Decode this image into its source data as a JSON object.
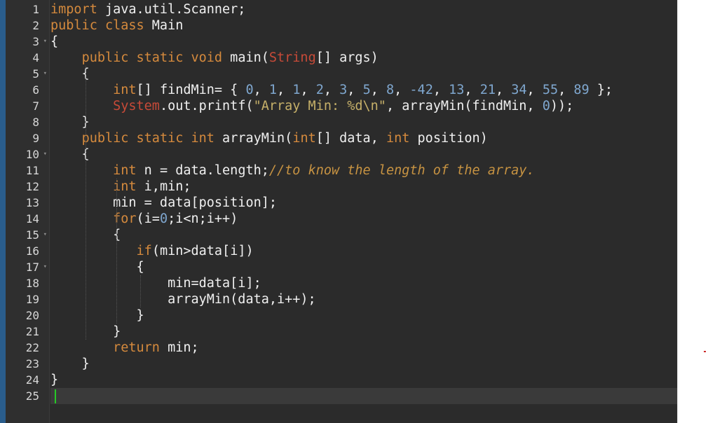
{
  "editor": {
    "lines": [
      {
        "n": "1",
        "fold": "",
        "tokens": [
          [
            "kw",
            "import"
          ],
          [
            "txt",
            " java.util.Scanner;"
          ]
        ]
      },
      {
        "n": "2",
        "fold": "",
        "tokens": [
          [
            "kw",
            "public class"
          ],
          [
            "txt",
            " Main"
          ]
        ]
      },
      {
        "n": "3",
        "fold": "▾",
        "tokens": [
          [
            "txt",
            "{"
          ]
        ]
      },
      {
        "n": "4",
        "fold": "",
        "tokens": [
          [
            "txt",
            "    "
          ],
          [
            "kw",
            "public static void"
          ],
          [
            "txt",
            " main("
          ],
          [
            "red",
            "String"
          ],
          [
            "txt",
            "[] args)"
          ]
        ]
      },
      {
        "n": "5",
        "fold": "▾",
        "tokens": [
          [
            "txt",
            "    {"
          ]
        ]
      },
      {
        "n": "6",
        "fold": "",
        "tokens": [
          [
            "txt",
            "        "
          ],
          [
            "type",
            "int"
          ],
          [
            "txt",
            "[] findMin= { "
          ],
          [
            "num",
            "0"
          ],
          [
            "txt",
            ", "
          ],
          [
            "num",
            "1"
          ],
          [
            "txt",
            ", "
          ],
          [
            "num",
            "1"
          ],
          [
            "txt",
            ", "
          ],
          [
            "num",
            "2"
          ],
          [
            "txt",
            ", "
          ],
          [
            "num",
            "3"
          ],
          [
            "txt",
            ", "
          ],
          [
            "num",
            "5"
          ],
          [
            "txt",
            ", "
          ],
          [
            "num",
            "8"
          ],
          [
            "txt",
            ", "
          ],
          [
            "num",
            "-42"
          ],
          [
            "txt",
            ", "
          ],
          [
            "num",
            "13"
          ],
          [
            "txt",
            ", "
          ],
          [
            "num",
            "21"
          ],
          [
            "txt",
            ", "
          ],
          [
            "num",
            "34"
          ],
          [
            "txt",
            ", "
          ],
          [
            "num",
            "55"
          ],
          [
            "txt",
            ", "
          ],
          [
            "num",
            "89"
          ],
          [
            "txt",
            " };"
          ]
        ]
      },
      {
        "n": "7",
        "fold": "",
        "tokens": [
          [
            "txt",
            "        "
          ],
          [
            "red",
            "System"
          ],
          [
            "txt",
            ".out.printf("
          ],
          [
            "str",
            "\"Array Min: %d\\n\""
          ],
          [
            "txt",
            ", arrayMin(findMin, "
          ],
          [
            "num",
            "0"
          ],
          [
            "txt",
            "));"
          ]
        ]
      },
      {
        "n": "8",
        "fold": "",
        "tokens": [
          [
            "txt",
            "    }"
          ]
        ]
      },
      {
        "n": "9",
        "fold": "",
        "tokens": [
          [
            "txt",
            "    "
          ],
          [
            "kw",
            "public static int"
          ],
          [
            "txt",
            " arrayMin("
          ],
          [
            "type",
            "int"
          ],
          [
            "txt",
            "[] data, "
          ],
          [
            "type",
            "int"
          ],
          [
            "txt",
            " position)"
          ]
        ]
      },
      {
        "n": "10",
        "fold": "▾",
        "tokens": [
          [
            "txt",
            "    {"
          ]
        ]
      },
      {
        "n": "11",
        "fold": "",
        "tokens": [
          [
            "txt",
            "        "
          ],
          [
            "type",
            "int"
          ],
          [
            "txt",
            " n = data.length;"
          ],
          [
            "cmt",
            "//to know the length of the array."
          ]
        ]
      },
      {
        "n": "12",
        "fold": "",
        "tokens": [
          [
            "txt",
            "        "
          ],
          [
            "type",
            "int"
          ],
          [
            "txt",
            " i,min;"
          ]
        ]
      },
      {
        "n": "13",
        "fold": "",
        "tokens": [
          [
            "txt",
            "        min = data[position];"
          ]
        ]
      },
      {
        "n": "14",
        "fold": "",
        "tokens": [
          [
            "txt",
            "        "
          ],
          [
            "kw",
            "for"
          ],
          [
            "txt",
            "(i="
          ],
          [
            "num",
            "0"
          ],
          [
            "txt",
            ";i<n;i++)"
          ]
        ]
      },
      {
        "n": "15",
        "fold": "▾",
        "tokens": [
          [
            "txt",
            "        {"
          ]
        ]
      },
      {
        "n": "16",
        "fold": "",
        "tokens": [
          [
            "txt",
            "           "
          ],
          [
            "kw",
            "if"
          ],
          [
            "txt",
            "(min>data[i])"
          ]
        ]
      },
      {
        "n": "17",
        "fold": "▾",
        "tokens": [
          [
            "txt",
            "           {"
          ]
        ]
      },
      {
        "n": "18",
        "fold": "",
        "tokens": [
          [
            "txt",
            "               min=data[i];"
          ]
        ]
      },
      {
        "n": "19",
        "fold": "",
        "tokens": [
          [
            "txt",
            "               arrayMin(data,i++);"
          ]
        ]
      },
      {
        "n": "20",
        "fold": "",
        "tokens": [
          [
            "txt",
            "           }"
          ]
        ]
      },
      {
        "n": "21",
        "fold": "",
        "tokens": [
          [
            "txt",
            "        }"
          ]
        ]
      },
      {
        "n": "22",
        "fold": "",
        "tokens": [
          [
            "txt",
            "        "
          ],
          [
            "kw",
            "return"
          ],
          [
            "txt",
            " min;"
          ]
        ]
      },
      {
        "n": "23",
        "fold": "",
        "tokens": [
          [
            "txt",
            "    }"
          ]
        ]
      },
      {
        "n": "24",
        "fold": "",
        "tokens": [
          [
            "txt",
            "}"
          ]
        ]
      },
      {
        "n": "25",
        "fold": "",
        "tokens": []
      }
    ]
  }
}
